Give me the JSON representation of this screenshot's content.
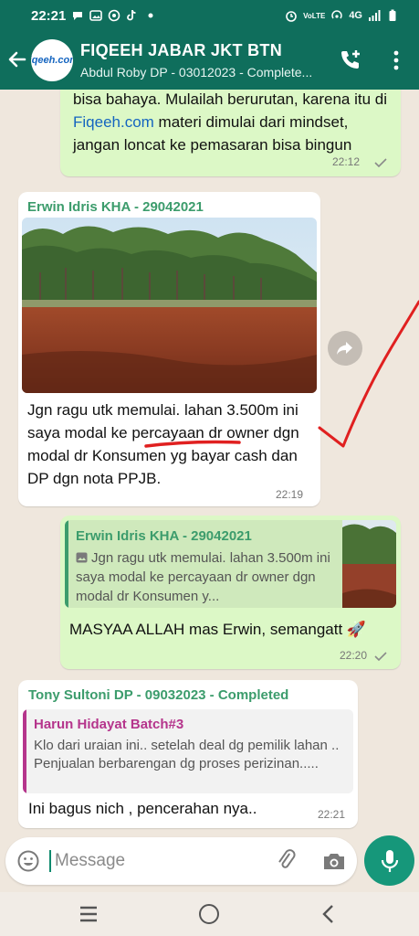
{
  "status_bar": {
    "time": "22:21",
    "network": "4G",
    "lte_label": "VoLTE"
  },
  "header": {
    "title": "FIQEEH JABAR JKT BTN",
    "subtitle": "Abdul Roby DP - 03012023 - Complete...",
    "avatar_label": "fiqeeh.com"
  },
  "messages": [
    {
      "type": "outgoing",
      "text_before_link": "bisa bahaya. Mulailah berurutan, karena itu di ",
      "link": "Fiqeeh.com",
      "text_after_link": " materi dimulai dari mindset, jangan loncat ke pemasaran bisa bingun",
      "time": "22:12"
    },
    {
      "type": "incoming",
      "sender": "Erwin Idris KHA - 29042021",
      "text": "Jgn ragu utk memulai. lahan 3.500m ini saya modal ke percayaan dr owner dgn modal dr Konsumen yg bayar cash dan DP dgn nota PPJB.",
      "time": "22:19"
    },
    {
      "type": "outgoing",
      "quote_sender": "Erwin Idris KHA - 29042021",
      "quote_text": "Jgn ragu utk memulai. lahan 3.500m ini saya modal ke percayaan dr owner dgn modal dr Konsumen y...",
      "text": "MASYAA ALLAH mas Erwin, semangatt 🚀",
      "time": "22:20"
    },
    {
      "type": "incoming",
      "sender": "Tony Sultoni DP - 09032023 - Completed",
      "quote_sender": "Harun Hidayat Batch#3",
      "quote_text": "Klo dari uraian ini.. setelah deal dg pemilik lahan .. Penjualan berbarengan dg proses perizinan.....",
      "text": "Ini bagus nich , pencerahan nya..",
      "time": "22:21"
    }
  ],
  "input": {
    "placeholder": "Message"
  },
  "icons": {
    "back": "arrow-left-icon",
    "call": "add-call-icon",
    "menu": "more-vert-icon",
    "forward": "forward-icon",
    "emoji": "emoji-icon",
    "attach": "paperclip-icon",
    "camera": "camera-icon",
    "mic": "mic-icon"
  },
  "colors": {
    "header": "#0f6e5c",
    "outgoing_bubble": "#dcf8c6",
    "incoming_bubble": "#ffffff",
    "sender_green": "#3c9c6c",
    "quote_magenta": "#b5358c",
    "annotation_red": "#e02020"
  }
}
